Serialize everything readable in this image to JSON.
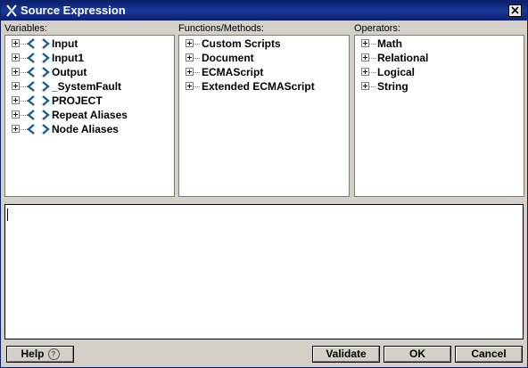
{
  "window": {
    "title": "Source Expression"
  },
  "variables": {
    "label": "Variables:",
    "items": [
      "Input",
      "Input1",
      "Output",
      "_SystemFault",
      "PROJECT",
      "Repeat Aliases",
      "Node Aliases"
    ]
  },
  "functions": {
    "label": "Functions/Methods:",
    "items": [
      "Custom Scripts",
      "Document",
      "ECMAScript",
      "Extended ECMAScript"
    ]
  },
  "operators": {
    "label": "Operators:",
    "items": [
      "Math",
      "Relational",
      "Logical",
      "String"
    ]
  },
  "editor": {
    "value": ""
  },
  "buttons": {
    "help": "Help",
    "validate": "Validate",
    "ok": "OK",
    "cancel": "Cancel"
  },
  "colors": {
    "titlebar": "#0b1f6d",
    "dialog_bg": "#d4d0c8",
    "var_icon": "#1a5f8c"
  }
}
